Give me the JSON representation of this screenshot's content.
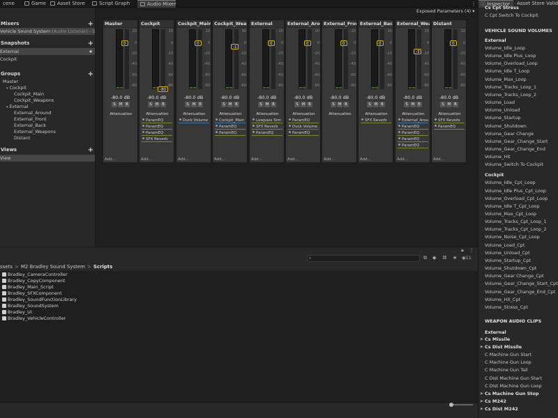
{
  "tabs": [
    {
      "label": "cene",
      "active": false
    },
    {
      "label": "Game",
      "active": false
    },
    {
      "label": "Asset Store",
      "active": false
    },
    {
      "label": "Script Graph",
      "active": false
    },
    {
      "label": "Audio Mixer",
      "active": true
    }
  ],
  "exposed_label": "Exposed Parameters (4)",
  "left": {
    "mixers_title": "Mixers",
    "mixers": [
      {
        "name": "Vehicle Sound System",
        "note": "(Audio Listener) - S"
      }
    ],
    "snapshots_title": "Snapshots",
    "snapshots": [
      "External",
      "Cockpit"
    ],
    "groups_title": "Groups",
    "groups": [
      "Master",
      "Cockpit",
      "Cockpit_Main",
      "Cockpit_Weapons",
      "External",
      "External_Around",
      "External_Front",
      "External_Back",
      "External_Weapons",
      "Distant"
    ],
    "views_title": "Views",
    "views": [
      "View"
    ]
  },
  "strips": [
    {
      "name": "Master",
      "knob": "0",
      "db": "-80.0 dB",
      "effects": [
        {
          "t": "Attenuation",
          "s": "plain"
        }
      ]
    },
    {
      "name": "Cockpit",
      "knob": "-80",
      "db": "-80.0 dB",
      "effects": [
        {
          "t": "Attenuation",
          "s": "plain"
        },
        {
          "t": "ParamEQ",
          "s": "hl"
        },
        {
          "t": "ParamEQ",
          "s": "hl"
        },
        {
          "t": "ParamEQ",
          "s": "hl"
        },
        {
          "t": "SFX Reverb",
          "s": "hl"
        }
      ]
    },
    {
      "name": "Cockpit_Main",
      "knob": "0",
      "db": "-80.0 dB",
      "effects": [
        {
          "t": "Attenuation",
          "s": "plain"
        },
        {
          "t": "Duck Volume",
          "s": "blue"
        }
      ]
    },
    {
      "name": "Cockpit_Weap",
      "knob": "-1",
      "db": "-80.0 dB",
      "effects": [
        {
          "t": "Attenuation",
          "s": "plain"
        },
        {
          "t": "Cockpit_Main",
          "s": "blue"
        },
        {
          "t": "ParamEQ",
          "s": "hl"
        },
        {
          "t": "ParamEQ",
          "s": "hl"
        }
      ]
    },
    {
      "name": "External",
      "knob": "0",
      "db": "-80.0 dB",
      "effects": [
        {
          "t": "Attenuation",
          "s": "plain"
        },
        {
          "t": "Lowpass Sim",
          "s": "hl"
        },
        {
          "t": "SFX Reverb",
          "s": "hl"
        },
        {
          "t": "ParamEQ",
          "s": "hl"
        }
      ]
    },
    {
      "name": "External_Arou",
      "knob": "0",
      "db": "-80.0 dB",
      "effects": [
        {
          "t": "Attenuation",
          "s": "plain"
        },
        {
          "t": "ParamEQ",
          "s": "hl"
        },
        {
          "t": "Duck Volume",
          "s": "blue"
        },
        {
          "t": "ParamEQ",
          "s": "hl"
        }
      ]
    },
    {
      "name": "External_Fron",
      "knob": "0",
      "db": "-80.0 dB",
      "effects": [
        {
          "t": "Attenuation",
          "s": "plain"
        }
      ]
    },
    {
      "name": "External_Back",
      "knob": "0",
      "db": "-80.0 dB",
      "effects": [
        {
          "t": "Attenuation",
          "s": "plain"
        },
        {
          "t": "SFX Reverb",
          "s": "hl"
        }
      ]
    },
    {
      "name": "External_Weap",
      "knob": "-3",
      "db": "-80.0 dB",
      "effects": [
        {
          "t": "Attenuation",
          "s": "plain"
        },
        {
          "t": "External_Arou",
          "s": "blue"
        },
        {
          "t": "ParamEQ",
          "s": "hl"
        },
        {
          "t": "ParamEQ",
          "s": "hl"
        },
        {
          "t": "ParamEQ",
          "s": "hl"
        },
        {
          "t": "ParamEQ",
          "s": "hl"
        }
      ]
    },
    {
      "name": "Distant",
      "knob": "0",
      "db": "-80.0 dB",
      "effects": [
        {
          "t": "Attenuation",
          "s": "plain"
        },
        {
          "t": "SFX Reverb",
          "s": "hl"
        },
        {
          "t": "ParamEQ",
          "s": "hl"
        }
      ]
    }
  ],
  "strip_buttons": [
    "S",
    "M",
    "B"
  ],
  "add_label": "Add...",
  "scale_labels": [
    "20",
    "0",
    "-20",
    "-40",
    "-60",
    "-80"
  ],
  "project": {
    "breadcrumb": [
      "ssets",
      "M2 Bradley Sound System",
      "Scripts"
    ],
    "assets": [
      "Bradley_CameraController",
      "Bradley_CopyComponent",
      "Bradley_Main_Script",
      "Bradley_SFXComponent",
      "Bradley_SoundFunctionLibrary",
      "Bradley_SoundSystem",
      "Bradley_UI",
      "Bradley_VehicleController"
    ],
    "count": "11"
  },
  "inspector": {
    "tabs": [
      "Inspector",
      "Asset Store Validat"
    ],
    "top_lines": [
      "Cs Cpt Stress",
      "C Cpt Switch To Cockpit"
    ],
    "sections": [
      {
        "header": "VEHICLE SOUND VOLUMES",
        "sub": "External",
        "items": [
          "Volume_Idle_Loop",
          "Volume_Idle Plus_Loop",
          "Volume_Overload_Loop",
          "Volume_Idle T_Loop",
          "Volume_Max_Loop",
          "Volume_Tracks_Loop_1",
          "Volume_Tracks_Loop_2",
          "Volume_Load",
          "Volume_Unload",
          "Volume_Startup",
          "Volume_Shutdown",
          "Volume_Gear Change",
          "Volume_Gear_Change_Start",
          "Volume_Gear_Change_End",
          "Volume_Hit",
          "Volume_Switch To Cockpit"
        ]
      },
      {
        "header": "",
        "sub": "Cockpit",
        "items": [
          "Volume_Idle_Cpt_Loop",
          "Volume_Idle Plus_Cpt_Loop",
          "Volume_Overload_Cpt_Loop",
          "Volume_Idle T_Cpt_Loop",
          "Volume_Max_Cpt_Loop",
          "Volume_Tracks_Cpt_Loop_1",
          "Volume_Tracks_Cpt_Loop_2",
          "Volume_Noise_Cpt_Loop",
          "Volume_Load_Cpt",
          "Volume_Unload_Cpt",
          "Volume_Startup_Cpt",
          "Volume_Shutdown_Cpt",
          "Volume_Gear Change_Cpt",
          "Volume_Gear_Change_Start_Cpt",
          "Volume_Gear_Change_End_Cpt",
          "Volume_Hit_Cpt",
          "Volume_Stress_Cpt"
        ]
      }
    ],
    "weapon_header": "WEAPON AUDIO CLIPS",
    "weapon_sub": "External",
    "weapon_items": [
      {
        "t": "Cs Missile",
        "arrow": true,
        "bold": true
      },
      {
        "t": "Cs Dist Missile",
        "arrow": true,
        "bold": true
      },
      {
        "t": "C Machine Gun Start",
        "arrow": false,
        "bold": false
      },
      {
        "t": "C Machine Gun Loop",
        "arrow": false,
        "bold": false
      },
      {
        "t": "C Machine Gun Tail",
        "arrow": false,
        "bold": false
      },
      {
        "t": "C Dist Machine Gun Start",
        "arrow": false,
        "bold": false
      },
      {
        "t": "C Dist Machine Gun Loop",
        "arrow": false,
        "bold": false
      },
      {
        "t": "Cs Machine Gun Stop",
        "arrow": true,
        "bold": true
      },
      {
        "t": "Cs M242",
        "arrow": true,
        "bold": true
      },
      {
        "t": "Cs Dist M242",
        "arrow": true,
        "bold": true
      }
    ]
  }
}
